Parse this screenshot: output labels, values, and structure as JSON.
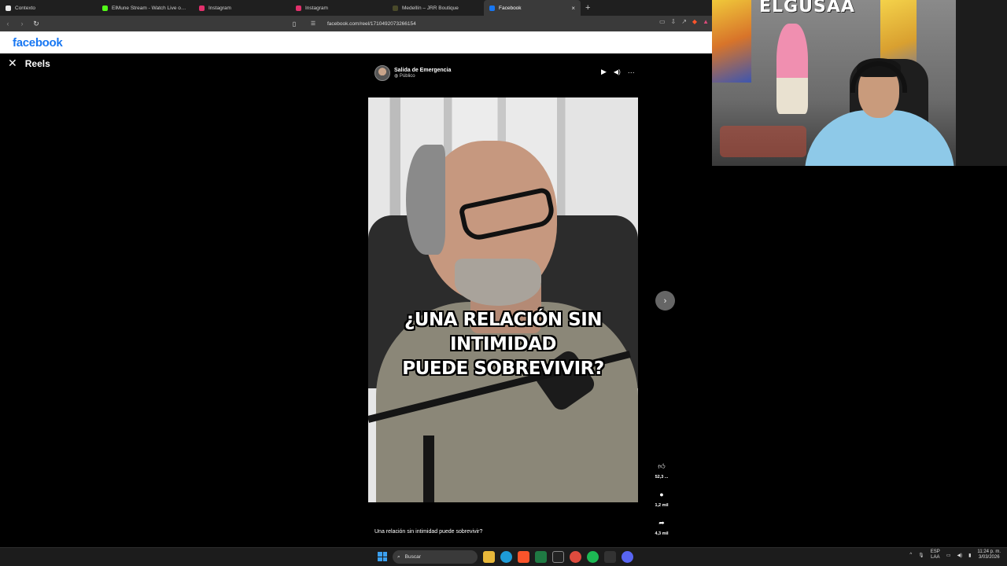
{
  "browser": {
    "tabs": [
      {
        "title": "Contexto",
        "active": false,
        "favicon_color": "#e9e9e9"
      },
      {
        "title": "ElMune Stream - Watch Live on Kick",
        "active": false,
        "favicon_color": "#53fc18"
      },
      {
        "title": "Instagram",
        "active": false,
        "favicon_color": "#e1306c"
      },
      {
        "title": "Instagram",
        "active": false,
        "favicon_color": "#e1306c"
      },
      {
        "title": "Medellín – JRR Boutique",
        "active": false,
        "favicon_color": "#4a4a2a"
      },
      {
        "title": "Facebook",
        "active": true,
        "favicon_color": "#1877f2"
      }
    ],
    "new_tab": "+",
    "close_tab": "×",
    "url": "facebook.com/reel/1710492073266154"
  },
  "facebook": {
    "logo": "facebook",
    "brand_color": "#1877f2"
  },
  "reels": {
    "close": "✕",
    "title": "Reels",
    "author": {
      "name": "Salida de Emergencia",
      "privacy": "Público"
    },
    "controls": {
      "play": "▶",
      "mute": "🔇",
      "more": "···"
    },
    "video_caption_line1": "¿UNA RELACIÓN SIN INTIMIDAD",
    "video_caption_line2": "PUEDE SOBREVIVIR?",
    "next": "›",
    "actions": [
      {
        "icon": "like-icon",
        "glyph": "👍",
        "count": "52,3 ..."
      },
      {
        "icon": "comment-icon",
        "glyph": "●",
        "count": "1,2 mil"
      },
      {
        "icon": "share-icon",
        "glyph": "➦",
        "count": "4,3 mil"
      }
    ],
    "description": "Una relación sin intimidad puede sobrevivir?"
  },
  "webcam": {
    "sign_text": "ELGUSAA"
  },
  "taskbar": {
    "search_placeholder": "Buscar",
    "lang_line1": "ESP",
    "lang_line2": "LAA",
    "time": "11:24 p. m.",
    "date": "3/03/2026"
  }
}
